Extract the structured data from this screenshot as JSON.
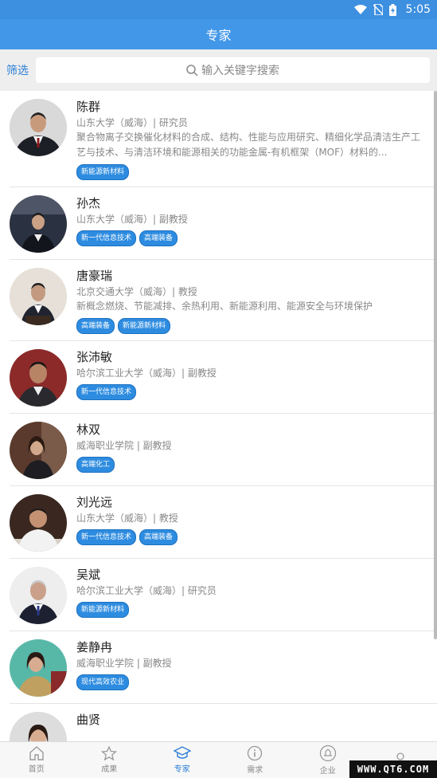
{
  "status_bar": {
    "time": "5:05"
  },
  "app_bar": {
    "title": "专家"
  },
  "search": {
    "filter_label": "筛选",
    "placeholder": "输入关键字搜索"
  },
  "experts": [
    {
      "name": "陈群",
      "org": "山东大学（威海）| 研究员",
      "desc": "聚合物离子交换催化材料的合成、结构、性能与应用研究、精细化学品清洁生产工艺与技术、与清洁环境和能源相关的功能金属-有机框架（MOF）材料的...",
      "tags": [
        "新能源新材料"
      ]
    },
    {
      "name": "孙杰",
      "org": "山东大学（威海）| 副教授",
      "desc": "",
      "tags": [
        "新一代信息技术",
        "高端装备"
      ]
    },
    {
      "name": "唐豪瑞",
      "org": "北京交通大学（威海）| 教授",
      "desc": "新概念燃烧、节能减排、余热利用、新能源利用、能源安全与环境保护",
      "tags": [
        "高端装备",
        "新能源新材料"
      ]
    },
    {
      "name": "张沛敏",
      "org": "哈尔滨工业大学（威海）| 副教授",
      "desc": "",
      "tags": [
        "新一代信息技术"
      ]
    },
    {
      "name": "林双",
      "org": "威海职业学院 | 副教授",
      "desc": "",
      "tags": [
        "高端化工"
      ]
    },
    {
      "name": "刘光远",
      "org": "山东大学（威海）| 教授",
      "desc": "",
      "tags": [
        "新一代信息技术",
        "高端装备"
      ]
    },
    {
      "name": "吴斌",
      "org": "哈尔滨工业大学（威海）| 研究员",
      "desc": "",
      "tags": [
        "新能源新材料"
      ]
    },
    {
      "name": "姜静冉",
      "org": "威海职业学院 | 副教授",
      "desc": "",
      "tags": [
        "现代高效农业"
      ]
    },
    {
      "name": "曲贤",
      "org": "",
      "desc": "",
      "tags": []
    }
  ],
  "tabs": [
    {
      "label": "首页",
      "icon": "home-icon"
    },
    {
      "label": "成果",
      "icon": "star-icon"
    },
    {
      "label": "专家",
      "icon": "graduation-cap-icon"
    },
    {
      "label": "需求",
      "icon": "info-icon"
    },
    {
      "label": "企业",
      "icon": "enterprise-icon"
    },
    {
      "label": "",
      "icon": "user-icon"
    }
  ],
  "watermark": "WWW.QT6.COM",
  "colors": {
    "primary": "#4297e8",
    "tag": "#2e8ce0",
    "filter": "#2d7fd6"
  }
}
